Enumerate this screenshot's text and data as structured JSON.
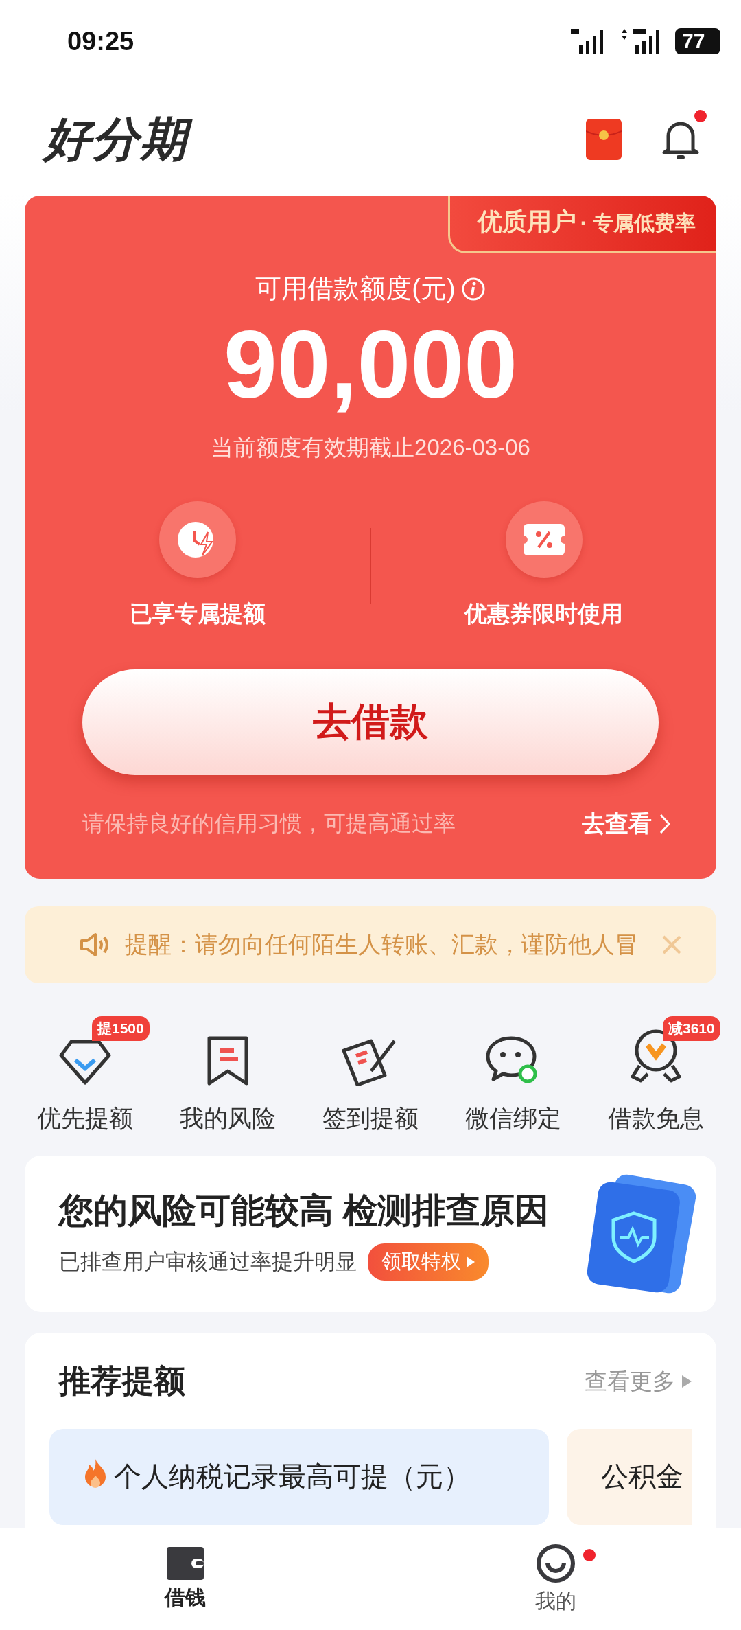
{
  "status_bar": {
    "time": "09:25",
    "battery": "77"
  },
  "header": {
    "logo": "好分期",
    "has_unread": true
  },
  "credit_card": {
    "tag_main": "优质用户",
    "tag_sub": "· 专属低费率",
    "label": "可用借款额度(元)",
    "amount": "90,000",
    "validity": "当前额度有效期截止2026-03-06",
    "features": [
      {
        "kind": "clock",
        "label": "已享专属提额"
      },
      {
        "kind": "coupon",
        "label": "优惠券限时使用"
      }
    ],
    "button": "去借款",
    "footer_text": "请保持良好的信用习惯，可提高通过率",
    "footer_link": "去查看"
  },
  "notice": {
    "text": "提醒：请勿向任何陌生人转账、汇款，谨防他人冒"
  },
  "shortcuts": [
    {
      "kind": "diamond",
      "label": "优先提额",
      "badge": "提1500"
    },
    {
      "kind": "bookmark",
      "label": "我的风险"
    },
    {
      "kind": "sign",
      "label": "签到提额"
    },
    {
      "kind": "chat",
      "label": "微信绑定"
    },
    {
      "kind": "medal",
      "label": "借款免息",
      "badge": "减3610"
    }
  ],
  "risk_banner": {
    "title": "您的风险可能较高 检测排查原因",
    "subtitle": "已排查用户审核通过率提升明显",
    "button": "领取特权"
  },
  "recommend": {
    "title": "推荐提额",
    "more": "查看更多",
    "items": [
      {
        "kind": "tax",
        "title": "个人纳税记录最高可提（元）"
      },
      {
        "kind": "fund",
        "title": "公积金"
      }
    ]
  },
  "bottom_nav": [
    {
      "kind": "wallet",
      "label": "借钱",
      "selected": true,
      "has_dot": false
    },
    {
      "kind": "face",
      "label": "我的",
      "selected": false,
      "has_dot": true
    }
  ]
}
